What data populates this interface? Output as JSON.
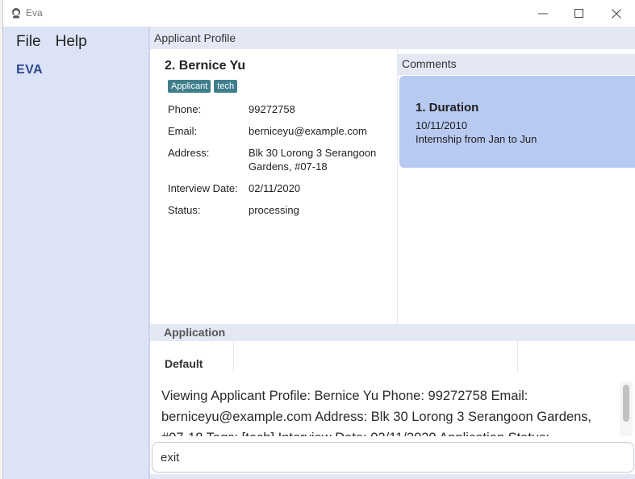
{
  "window": {
    "title": "Eva",
    "controls": [
      "minimize",
      "maximize",
      "close"
    ]
  },
  "menu": {
    "items": [
      "File",
      "Help"
    ]
  },
  "sidebar": {
    "brand": "EVA"
  },
  "main": {
    "section_title": "Applicant Profile",
    "profile": {
      "name": "2.  Bernice Yu",
      "tags": [
        "Applicant",
        "tech"
      ],
      "fields": [
        {
          "label": "Phone:",
          "value": "99272758"
        },
        {
          "label": "Email:",
          "value": "berniceyu@example.com"
        },
        {
          "label": "Address:",
          "value": "Blk 30 Lorong 3 Serangoon Gardens, #07-18"
        },
        {
          "label": "Interview Date:",
          "value": "02/11/2020"
        },
        {
          "label": "Status:",
          "value": "processing"
        }
      ]
    },
    "comments": {
      "title": "Comments",
      "items": [
        {
          "title": "1.  Duration",
          "date": "10/11/2010",
          "description": "Internship from Jan to Jun"
        }
      ]
    },
    "application": {
      "title": "Application",
      "tabs": [
        "Default"
      ]
    },
    "result": {
      "text": "Viewing Applicant Profile: Bernice Yu Phone: 99272758 Email: berniceyu@example.com Address: Blk 30 Lorong 3 Serangoon Gardens, #07-18 Tags: [tech] Interview Date: 02/11/2020 Application Status: processing"
    },
    "command": {
      "value": "exit"
    }
  },
  "colors": {
    "sidebar": "#dde3f6",
    "header": "#e4e8f5",
    "tag": "#3f7f8c",
    "comment_card": "#b8caf2",
    "brand": "#2c4a8c"
  }
}
